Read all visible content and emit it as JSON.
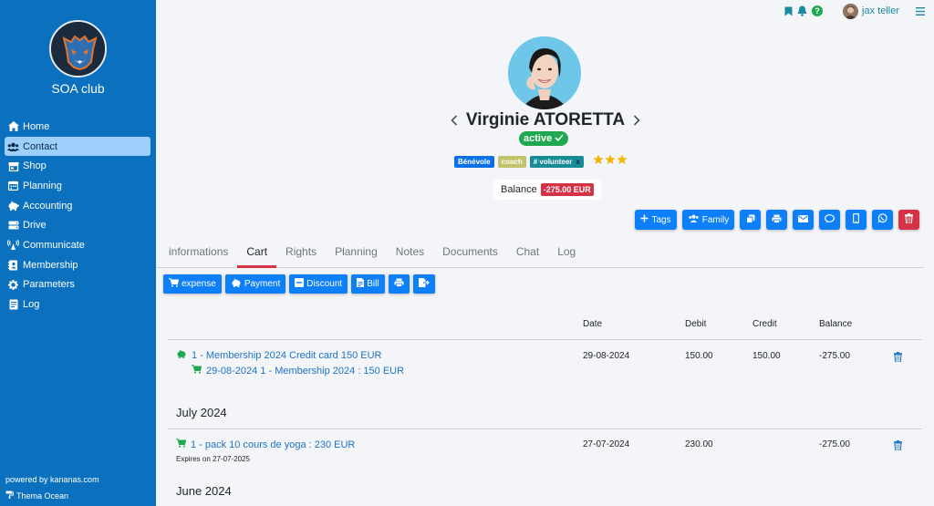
{
  "club": {
    "name": "SOA club"
  },
  "nav": [
    {
      "label": "Home",
      "icon": "home-icon"
    },
    {
      "label": "Contact",
      "icon": "users-icon",
      "active": true
    },
    {
      "label": "Shop",
      "icon": "store-icon"
    },
    {
      "label": "Planning",
      "icon": "calendar-icon"
    },
    {
      "label": "Accounting",
      "icon": "piggy-bank-icon"
    },
    {
      "label": "Drive",
      "icon": "drive-icon"
    },
    {
      "label": "Communicate",
      "icon": "broadcast-icon"
    },
    {
      "label": "Membership",
      "icon": "id-card-icon"
    },
    {
      "label": "Parameters",
      "icon": "gear-icon"
    },
    {
      "label": "Log",
      "icon": "log-icon"
    }
  ],
  "footer": {
    "powered": "powered by kananas.com",
    "theme": "Thema Ocean"
  },
  "topbar": {
    "user": "jax teller"
  },
  "profile": {
    "name": "Virginie ATORETTA",
    "status": "active",
    "tags": [
      "Bénévole",
      "coach",
      "# volunteer"
    ],
    "tag_remove": "x",
    "stars": 3,
    "balance_label": "Balance",
    "balance_value": "-275.00 EUR"
  },
  "actions": {
    "tags": "Tags",
    "family": "Family"
  },
  "tabs": [
    "informations",
    "Cart",
    "Rights",
    "Planning",
    "Notes",
    "Documents",
    "Chat",
    "Log"
  ],
  "active_tab": "Cart",
  "cart_actions": [
    "expense",
    "Payment",
    "Discount",
    "Bill"
  ],
  "table": {
    "headers": {
      "date": "Date",
      "debit": "Debit",
      "credit": "Credit",
      "balance": "Balance"
    },
    "rows": [
      {
        "title": "1 - Membership 2024 Credit card 150 EUR",
        "subtitle": "29-08-2024 1 - Membership 2024 : 150 EUR",
        "date": "29-08-2024",
        "debit": "150.00",
        "credit": "150.00",
        "balance": "-275.00"
      },
      {
        "month": "July 2024",
        "title": "1 - pack 10 cours de yoga : 230 EUR",
        "expires": "Expires on 27-07-2025",
        "date": "27-07-2024",
        "debit": "230.00",
        "credit": "",
        "balance": "-275.00"
      }
    ],
    "next_month": "June 2024"
  },
  "colors": {
    "sidebar": "#0b71bf",
    "primary": "#0d7ff8",
    "danger": "#d63245",
    "success": "#1fa84f",
    "link": "#1d73c4",
    "star": "#f5b400"
  }
}
